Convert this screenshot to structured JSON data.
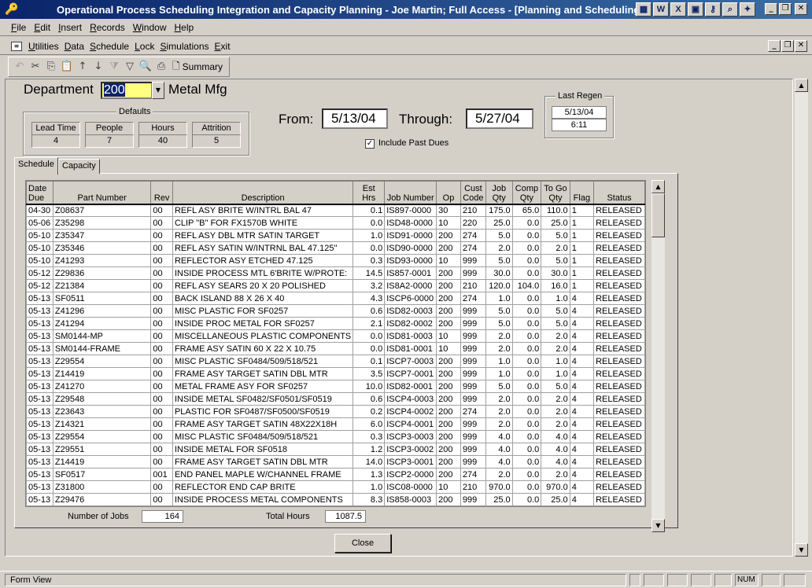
{
  "window": {
    "title": "Operational Process Scheduling Integration and Capacity Planning - Joe Martin; Full Access - [Planning and Scheduling]"
  },
  "menu": [
    "File",
    "Edit",
    "Insert",
    "Records",
    "Window",
    "Help"
  ],
  "menu2": [
    "Utilities",
    "Data",
    "Schedule",
    "Lock",
    "Simulations",
    "Exit"
  ],
  "toolbar": {
    "summary_label": "Summary"
  },
  "department": {
    "label": "Department",
    "value": "200",
    "name": "Metal Mfg"
  },
  "defaults": {
    "title": "Defaults",
    "items": [
      {
        "label": "Lead Time",
        "value": "4"
      },
      {
        "label": "People",
        "value": "7"
      },
      {
        "label": "Hours",
        "value": "40"
      },
      {
        "label": "Attrition",
        "value": "5"
      }
    ]
  },
  "range": {
    "from_label": "From:",
    "from": "5/13/04",
    "through_label": "Through:",
    "through": "5/27/04"
  },
  "include_past_dues": {
    "label": "Include Past Dues",
    "checked": true
  },
  "last_regen": {
    "title": "Last Regen",
    "date": "5/13/04",
    "time": "6:11"
  },
  "tabs": [
    "Schedule",
    "Capacity"
  ],
  "grid": {
    "columns": [
      "Date Due",
      "Part Number",
      "Rev",
      "Description",
      "Est Hrs",
      "Job Number",
      "Op",
      "Cust Code",
      "Job Qty",
      "Comp Qty",
      "To Go Qty",
      "Flag",
      "Status"
    ],
    "rows": [
      [
        "04-30",
        "Z08637",
        "00",
        "REFL ASY BRITE W/INTRL BAL 47",
        "0.1",
        "IS897-0000",
        "30",
        "210",
        "175.0",
        "65.0",
        "110.0",
        "1",
        "RELEASED"
      ],
      [
        "05-06",
        "Z35298",
        "00",
        "CLIP \"B\" FOR FX1570B WHITE",
        "0.0",
        "ISD48-0000",
        "10",
        "220",
        "25.0",
        "0.0",
        "25.0",
        "1",
        "RELEASED"
      ],
      [
        "05-10",
        "Z35347",
        "00",
        "REFL ASY DBL MTR SATIN TARGET",
        "1.0",
        "ISD91-0000",
        "200",
        "274",
        "5.0",
        "0.0",
        "5.0",
        "1",
        "RELEASED"
      ],
      [
        "05-10",
        "Z35346",
        "00",
        "REFL ASY SATIN W/INTRNL BAL 47.125\"",
        "0.0",
        "ISD90-0000",
        "200",
        "274",
        "2.0",
        "0.0",
        "2.0",
        "1",
        "RELEASED"
      ],
      [
        "05-10",
        "Z41293",
        "00",
        "REFLECTOR ASY ETCHED 47.125",
        "0.3",
        "ISD93-0000",
        "10",
        "999",
        "5.0",
        "0.0",
        "5.0",
        "1",
        "RELEASED"
      ],
      [
        "05-12",
        "Z29836",
        "00",
        "INSIDE PROCESS MTL 6'BRITE W/PROTE:",
        "14.5",
        "IS857-0001",
        "200",
        "999",
        "30.0",
        "0.0",
        "30.0",
        "1",
        "RELEASED"
      ],
      [
        "05-12",
        "Z21384",
        "00",
        "REFL ASY SEARS 20 X 20 POLISHED",
        "3.2",
        "IS8A2-0000",
        "200",
        "210",
        "120.0",
        "104.0",
        "16.0",
        "1",
        "RELEASED"
      ],
      [
        "05-13",
        "SF0511",
        "00",
        "BACK ISLAND 88 X 26 X 40",
        "4.3",
        "ISCP6-0000",
        "200",
        "274",
        "1.0",
        "0.0",
        "1.0",
        "4",
        "RELEASED"
      ],
      [
        "05-13",
        "Z41296",
        "00",
        "MISC PLASTIC FOR SF0257",
        "0.6",
        "ISD82-0003",
        "200",
        "999",
        "5.0",
        "0.0",
        "5.0",
        "4",
        "RELEASED"
      ],
      [
        "05-13",
        "Z41294",
        "00",
        "INSIDE PROC METAL FOR SF0257",
        "2.1",
        "ISD82-0002",
        "200",
        "999",
        "5.0",
        "0.0",
        "5.0",
        "4",
        "RELEASED"
      ],
      [
        "05-13",
        "SM0144-MP",
        "00",
        "MISCELLANEOUS PLASTIC COMPONENTS",
        "0.0",
        "ISD81-0003",
        "10",
        "999",
        "2.0",
        "0.0",
        "2.0",
        "4",
        "RELEASED"
      ],
      [
        "05-13",
        "SM0144-FRAME",
        "00",
        "FRAME ASY SATIN 60 X 22 X 10.75",
        "0.0",
        "ISD81-0001",
        "10",
        "999",
        "2.0",
        "0.0",
        "2.0",
        "4",
        "RELEASED"
      ],
      [
        "05-13",
        "Z29554",
        "00",
        "MISC PLASTIC SF0484/509/518/521",
        "0.1",
        "ISCP7-0003",
        "200",
        "999",
        "1.0",
        "0.0",
        "1.0",
        "4",
        "RELEASED"
      ],
      [
        "05-13",
        "Z14419",
        "00",
        "FRAME ASY TARGET SATIN DBL MTR",
        "3.5",
        "ISCP7-0001",
        "200",
        "999",
        "1.0",
        "0.0",
        "1.0",
        "4",
        "RELEASED"
      ],
      [
        "05-13",
        "Z41270",
        "00",
        "METAL FRAME ASY FOR SF0257",
        "10.0",
        "ISD82-0001",
        "200",
        "999",
        "5.0",
        "0.0",
        "5.0",
        "4",
        "RELEASED"
      ],
      [
        "05-13",
        "Z29548",
        "00",
        "INSIDE METAL SF0482/SF0501/SF0519",
        "0.6",
        "ISCP4-0003",
        "200",
        "999",
        "2.0",
        "0.0",
        "2.0",
        "4",
        "RELEASED"
      ],
      [
        "05-13",
        "Z23643",
        "00",
        "PLASTIC FOR SF0487/SF0500/SF0519",
        "0.2",
        "ISCP4-0002",
        "200",
        "274",
        "2.0",
        "0.0",
        "2.0",
        "4",
        "RELEASED"
      ],
      [
        "05-13",
        "Z14321",
        "00",
        "FRAME ASY TARGET SATIN 48X22X18H",
        "6.0",
        "ISCP4-0001",
        "200",
        "999",
        "2.0",
        "0.0",
        "2.0",
        "4",
        "RELEASED"
      ],
      [
        "05-13",
        "Z29554",
        "00",
        "MISC PLASTIC SF0484/509/518/521",
        "0.3",
        "ISCP3-0003",
        "200",
        "999",
        "4.0",
        "0.0",
        "4.0",
        "4",
        "RELEASED"
      ],
      [
        "05-13",
        "Z29551",
        "00",
        "INSIDE METAL FOR SF0518",
        "1.2",
        "ISCP3-0002",
        "200",
        "999",
        "4.0",
        "0.0",
        "4.0",
        "4",
        "RELEASED"
      ],
      [
        "05-13",
        "Z14419",
        "00",
        "FRAME ASY TARGET SATIN DBL MTR",
        "14.0",
        "ISCP3-0001",
        "200",
        "999",
        "4.0",
        "0.0",
        "4.0",
        "4",
        "RELEASED"
      ],
      [
        "05-13",
        "SF0517",
        "001",
        "END PANEL MAPLE W/CHANNEL FRAME",
        "1.3",
        "ISCP2-0000",
        "200",
        "274",
        "2.0",
        "0.0",
        "2.0",
        "4",
        "RELEASED"
      ],
      [
        "05-13",
        "Z31800",
        "00",
        "REFLECTOR END CAP BRITE",
        "1.0",
        "ISC08-0000",
        "10",
        "210",
        "970.0",
        "0.0",
        "970.0",
        "4",
        "RELEASED"
      ],
      [
        "05-13",
        "Z29476",
        "00",
        "INSIDE PROCESS METAL COMPONENTS",
        "8.3",
        "IS858-0003",
        "200",
        "999",
        "25.0",
        "0.0",
        "25.0",
        "4",
        "RELEASED"
      ]
    ]
  },
  "footer": {
    "jobs_label": "Number of Jobs",
    "jobs_value": "164",
    "hours_label": "Total Hours",
    "hours_value": "1087.5"
  },
  "close_label": "Close",
  "status": {
    "text": "Form View",
    "num": "NUM"
  }
}
